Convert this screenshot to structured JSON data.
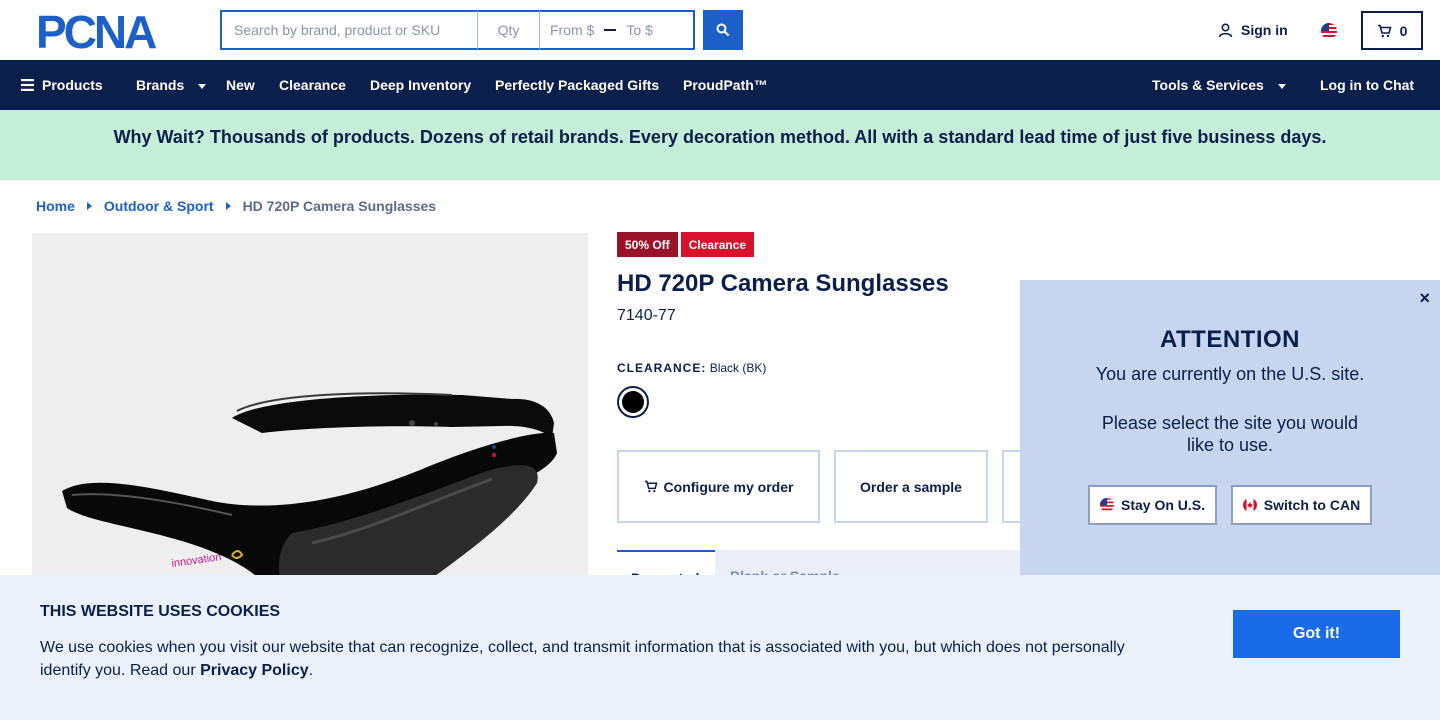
{
  "header": {
    "logo_text": "PCNA",
    "search_placeholder": "Search by brand, product or SKU",
    "qty_placeholder": "Qty",
    "price_from_placeholder": "From $",
    "price_to_placeholder": "To $",
    "signin_label": "Sign in",
    "cart_count": "0"
  },
  "nav": {
    "products": "Products",
    "brands": "Brands",
    "new": "New",
    "clearance": "Clearance",
    "deep_inventory": "Deep Inventory",
    "gifts": "Perfectly Packaged Gifts",
    "proudpath": "ProudPath™",
    "tools": "Tools & Services",
    "chat": "Log in to Chat"
  },
  "promo": {
    "text": "Why Wait? Thousands of products. Dozens of retail brands. Every decoration method. All with a standard lead time of just five business days."
  },
  "breadcrumb": {
    "home": "Home",
    "category": "Outdoor & Sport",
    "current": "HD 720P Camera Sunglasses"
  },
  "product": {
    "badge_discount": "50% Off",
    "badge_clearance": "Clearance",
    "title": "HD 720P Camera Sunglasses",
    "sku": "7140-77",
    "clearance_label": "CLEARANCE:",
    "color_value": "Black (BK)",
    "configure_label": "Configure my order",
    "sample_label": "Order a sample",
    "tab_active": "Decorated",
    "tab_other": "Blank or Sample"
  },
  "attention": {
    "close": "×",
    "title": "ATTENTION",
    "line1": "You are currently on the U.S. site.",
    "line2": "Please select the site you would like to use.",
    "stay_label": "Stay On U.S.",
    "switch_label": "Switch to CAN"
  },
  "cookie": {
    "title": "THIS WEBSITE USES COOKIES",
    "text": "We use cookies when you visit our website that can recognize, collect, and transmit information that is associated with you, but which does not personally identify you. Read our ",
    "policy_link": "Privacy Policy",
    "period": ".",
    "accept_label": "Got it!"
  },
  "colors": {
    "navy": "#0b1f4d",
    "accent_blue": "#1c5fc9",
    "promo_green": "#c4eed8",
    "badge_red": "#d8112d"
  }
}
